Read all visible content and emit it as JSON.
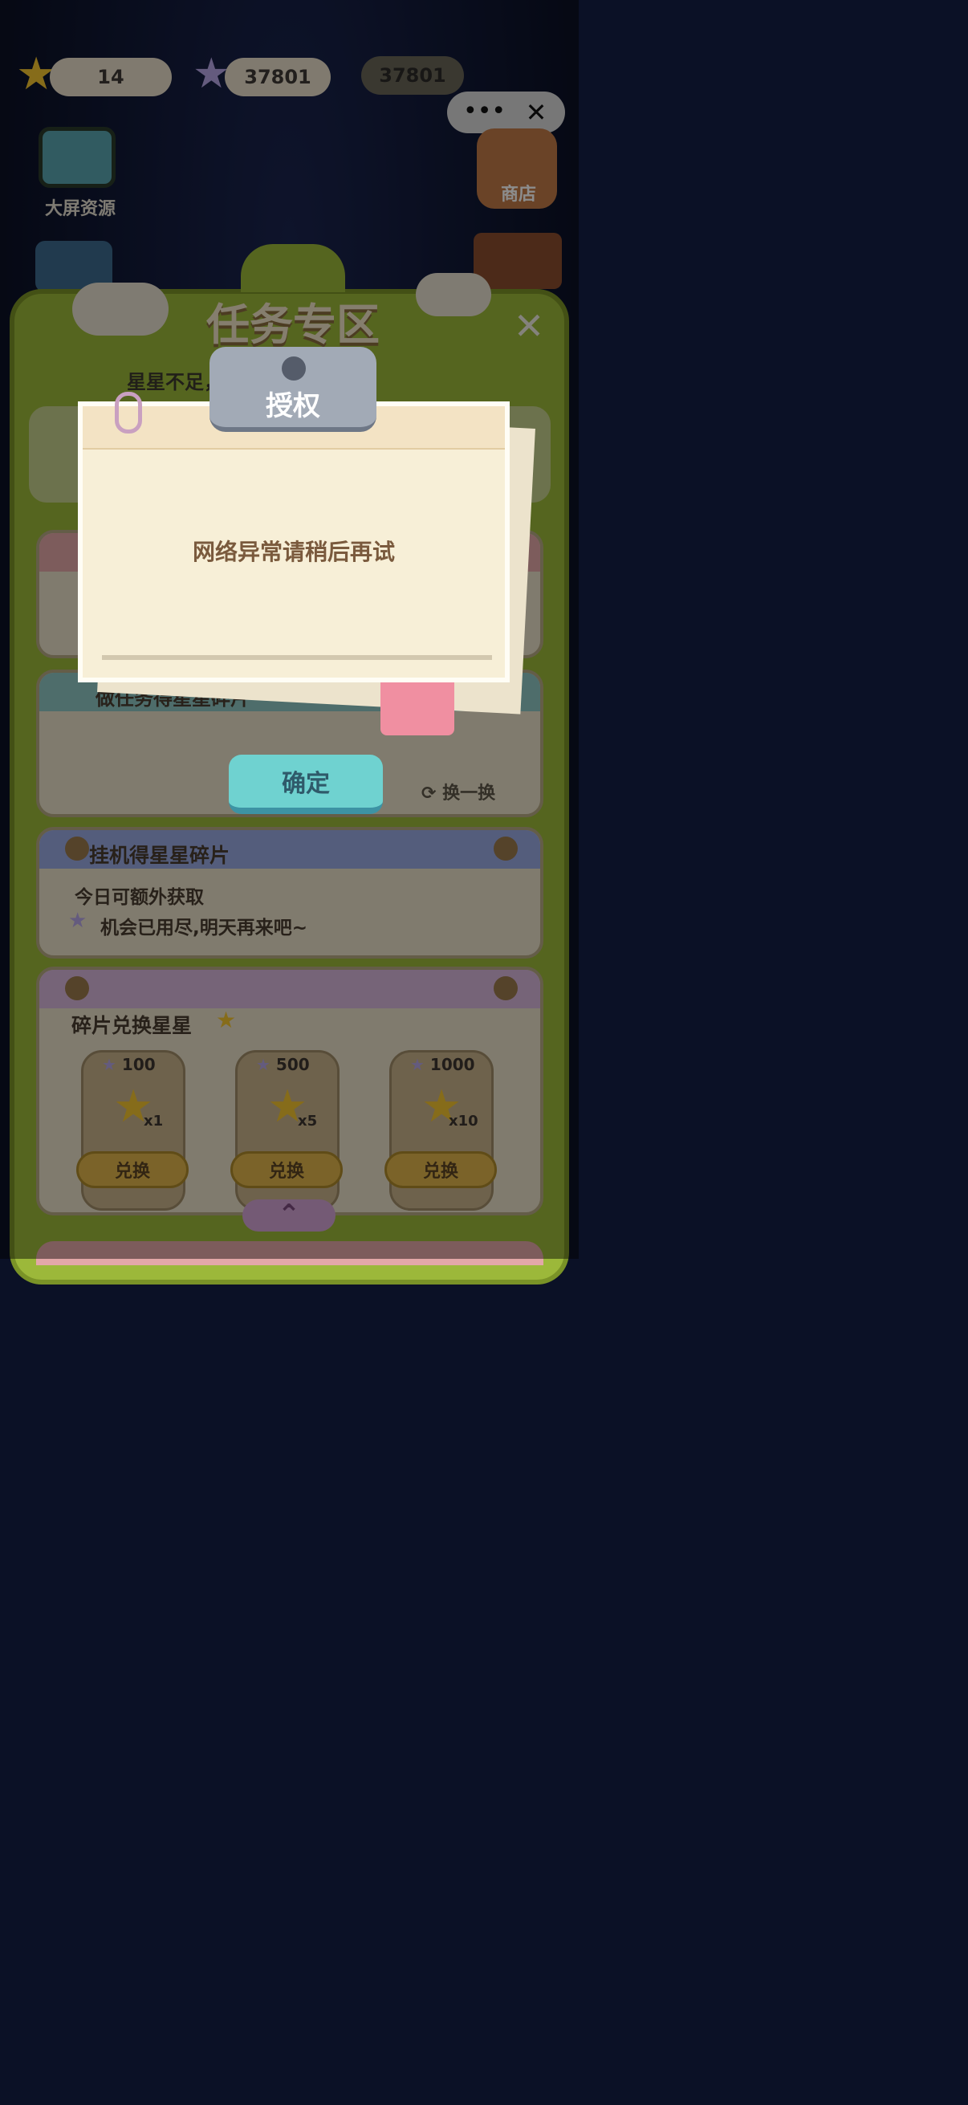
{
  "currency": {
    "stars": "14",
    "shards": "37801",
    "shards_alt": "37801"
  },
  "top_buttons": {
    "big_screen": "大屏资源",
    "shop": "商店"
  },
  "panel": {
    "title": "任务专区",
    "subtitle": "星星不足，参与活动获取吧！",
    "task_card_title": "做任务得星星碎片",
    "refresh": "换一换",
    "idle_title": "挂机得星星碎片",
    "idle_line1": "今日可额外获取",
    "idle_line2": "机会已用尽,明天再来吧~",
    "exchange_title": "碎片兑换星星",
    "exchange_items": [
      {
        "cost": "100",
        "reward": "x1",
        "button": "兑换"
      },
      {
        "cost": "500",
        "reward": "x5",
        "button": "兑换"
      },
      {
        "cost": "1000",
        "reward": "x10",
        "button": "兑换"
      }
    ]
  },
  "dialog": {
    "title": "授权",
    "message": "网络异常请稍后再试",
    "confirm": "确定"
  },
  "colors": {
    "panel_green": "#9cb83a",
    "confirm_teal": "#6fd2d0",
    "paper": "#f7efd7"
  }
}
